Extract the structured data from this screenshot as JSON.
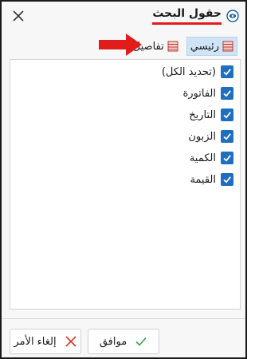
{
  "dialog": {
    "title": "حقول البحث",
    "accent_underline": "#e21b1b"
  },
  "tabs": [
    {
      "label": "رئيسي",
      "active": true
    },
    {
      "label": "تفاصيل",
      "active": false
    }
  ],
  "fields": [
    {
      "label": "(تحديد الكل)",
      "checked": true
    },
    {
      "label": "الفاتورة",
      "checked": true
    },
    {
      "label": "التاريخ",
      "checked": true
    },
    {
      "label": "الزبون",
      "checked": true
    },
    {
      "label": "الكمية",
      "checked": true
    },
    {
      "label": "القيمة",
      "checked": true
    }
  ],
  "buttons": {
    "ok_label": "موافق",
    "cancel_label": "إلغاء الأمر"
  },
  "colors": {
    "checkbox": "#1e6fbf",
    "active_tab": "#cfe4f7",
    "arrow": "#e21b1b"
  }
}
